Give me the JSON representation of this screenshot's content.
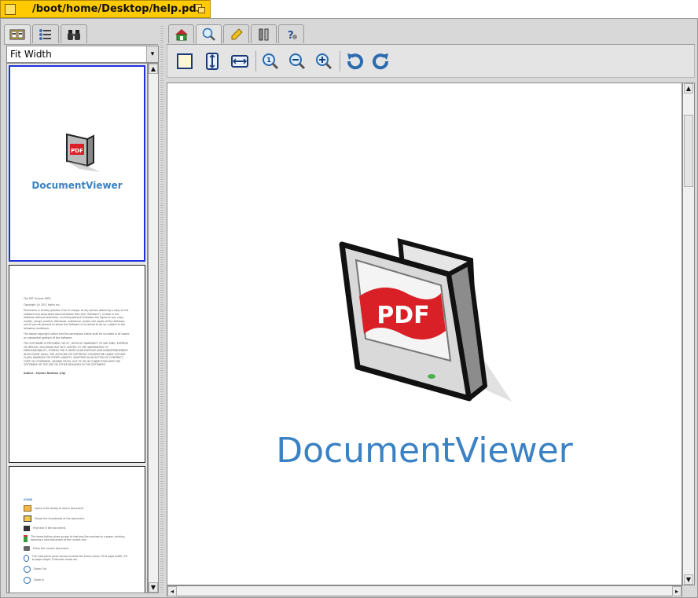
{
  "window": {
    "title": "/boot/home/Desktop/help.pdf"
  },
  "sidebar": {
    "tabs": [
      {
        "name": "thumbnails",
        "icon": "thumbnails-icon",
        "active": true
      },
      {
        "name": "outline",
        "icon": "outline-icon",
        "active": false
      },
      {
        "name": "search",
        "icon": "binoculars-icon",
        "active": false
      }
    ],
    "fit_select": "Fit Width",
    "pages": [
      {
        "caption": "DocumentViewer"
      },
      {
        "title_line": "The MIT License (MIT)",
        "copyright": "Copyright (c) 2011 Haiku Inc.",
        "para1": "Permission is hereby granted, free of charge, to any person obtaining a copy of this software and associated documentation files (the \"Software\"), to deal in the Software without restriction, including without limitation the rights to use, copy, modify, merge, publish, distribute, sublicense, and/or sell copies of the Software, and to permit persons to whom the Software is furnished to do so, subject to the following conditions:",
        "para2": "The above copyright notice and this permission notice shall be included in all copies or substantial portions of the Software.",
        "para3": "THE SOFTWARE IS PROVIDED \"AS IS\", WITHOUT WARRANTY OF ANY KIND, EXPRESS OR IMPLIED, INCLUDING BUT NOT LIMITED TO THE WARRANTIES OF MERCHANTABILITY, FITNESS FOR A PARTICULAR PURPOSE AND NONINFRINGEMENT. IN NO EVENT SHALL THE AUTHORS OR COPYRIGHT HOLDERS BE LIABLE FOR ANY CLAIM, DAMAGES OR OTHER LIABILITY, WHETHER IN AN ACTION OF CONTRACT, TORT OR OTHERWISE, ARISING FROM, OUT OF OR IN CONNECTION WITH THE SOFTWARE OR THE USE OR OTHER DEALINGS IN THE SOFTWARE.",
        "author": "Author : Ciprian Nedisan (cip)"
      },
      {
        "heading": "ICONS",
        "items": [
          "Opens a file dialog to load a document.",
          "Shows the thumbnails of the document.",
          "Find text in the document.",
          "The home-button gives access to features like preview to a paper, printing, opening a new document of the current one.",
          "Prints the current document.",
          "The view-panel gives access to tools like Zoom-in/out, Fit to page width / Fit to page height, Fullscreen mode etc.",
          "Zoom Out",
          "Zoom In"
        ]
      }
    ]
  },
  "main_tabs": [
    {
      "name": "home",
      "icon": "home-icon",
      "active": false
    },
    {
      "name": "view",
      "icon": "magnifier-icon",
      "active": true
    },
    {
      "name": "annotate",
      "icon": "highlighter-icon",
      "active": false
    },
    {
      "name": "tools",
      "icon": "tools-icon",
      "active": false
    },
    {
      "name": "help",
      "icon": "help-icon",
      "active": false
    }
  ],
  "toolbar": [
    {
      "name": "fit-page-button",
      "icon": "fit-page-icon"
    },
    {
      "name": "fit-height-button",
      "icon": "fit-height-icon"
    },
    {
      "name": "fit-width-button",
      "icon": "fit-width-icon"
    },
    {
      "name": "zoom-original-button",
      "icon": "zoom-original-icon"
    },
    {
      "name": "zoom-out-button",
      "icon": "zoom-out-icon"
    },
    {
      "name": "zoom-in-button",
      "icon": "zoom-in-icon"
    },
    {
      "name": "rotate-left-button",
      "icon": "rotate-left-icon"
    },
    {
      "name": "rotate-right-button",
      "icon": "rotate-right-icon"
    }
  ],
  "document": {
    "logo_text": "PDF",
    "caption": "DocumentViewer"
  },
  "colors": {
    "title_tab": "#ffcb00",
    "brand_blue": "#3b82c4",
    "pdf_red": "#d92027",
    "selection_blue": "#2030e0"
  }
}
